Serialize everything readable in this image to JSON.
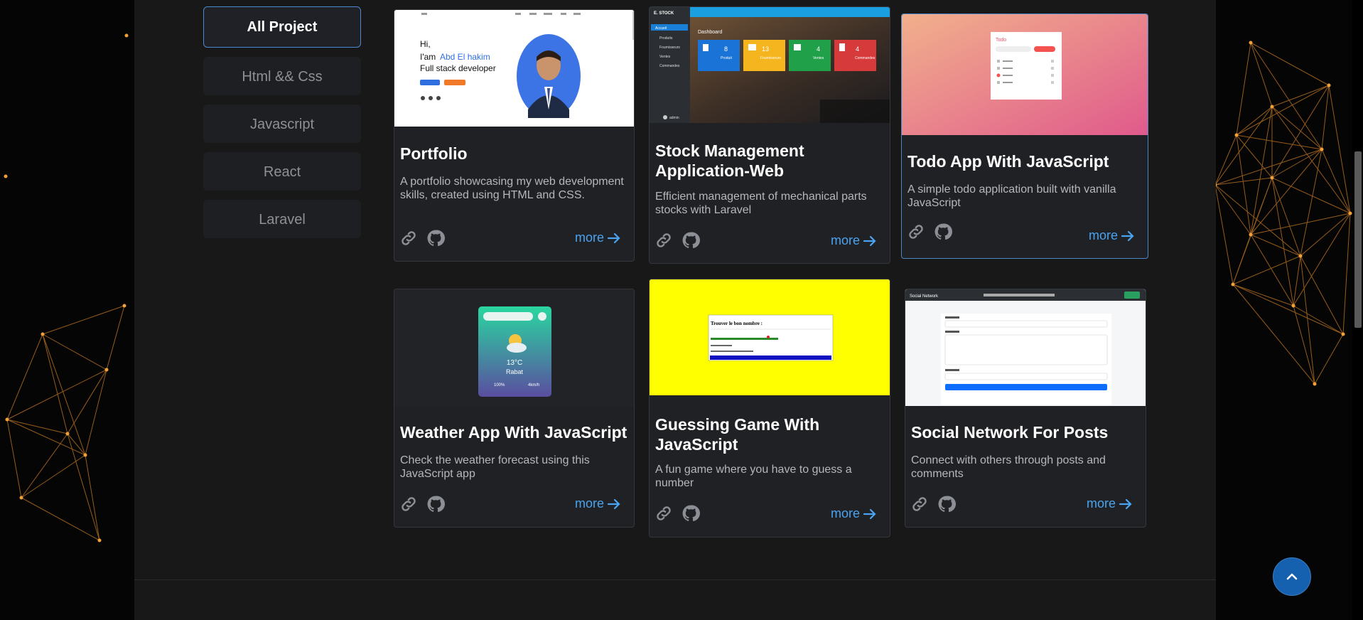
{
  "filters": [
    {
      "label": "All Project"
    },
    {
      "label": "Html && Css"
    },
    {
      "label": "Javascript"
    },
    {
      "label": "React"
    },
    {
      "label": "Laravel"
    }
  ],
  "active_filter": "All Project",
  "projects": [
    {
      "title": "Portfolio",
      "description": "A portfolio showcasing my web development skills, created using HTML and CSS.",
      "more": "more"
    },
    {
      "title": "Stock Management Application-Web",
      "description": "Efficient management of mechanical parts stocks with Laravel",
      "more": "more"
    },
    {
      "title": "Todo App With JavaScript",
      "description": "A simple todo application built with vanilla JavaScript",
      "more": "more"
    },
    {
      "title": "Weather App With JavaScript",
      "description": "Check the weather forecast using this JavaScript app",
      "more": "more"
    },
    {
      "title": "Guessing Game With JavaScript",
      "description": "A fun game where you have to guess a number",
      "more": "more"
    },
    {
      "title": "Social Network For Posts",
      "description": "Connect with others through posts and comments",
      "more": "more"
    }
  ],
  "thumbnails": {
    "portfolio": {
      "greeting": "Hi,",
      "intro": "I'am",
      "name": "Abd El hakim",
      "role": "Full stack developer"
    },
    "stock": {
      "brand": "E. STOCK",
      "heading": "Dashboard",
      "stats": [
        "8",
        "13",
        "4",
        "4"
      ],
      "stat_labels": [
        "Produit",
        "Fournisseurs",
        "Ventes",
        "Commandes"
      ],
      "menu": [
        "Accueil",
        "Produits",
        "Fournisseurs",
        "Ventes",
        "Commandes"
      ],
      "user": "admin"
    },
    "todo": {
      "heading": "Todo"
    },
    "weather": {
      "temp": "13°C",
      "city": "Rabat",
      "humidity": "100%",
      "wind": "4km/h"
    },
    "guess": {
      "heading": "Trouver le bon nombre :"
    },
    "social": {
      "brand": "Social Network"
    }
  },
  "colors": {
    "accent": "#4aa3f0",
    "panel": "#181818",
    "card": "#202124",
    "active_border": "#4a8ad0",
    "network": "#f2a13a",
    "scroll_top_button": "#1660b0"
  },
  "icons": {
    "link": "link-icon",
    "github": "github-icon",
    "more_arrow": "arrow-right-icon",
    "scroll_top": "chevron-up-icon"
  }
}
